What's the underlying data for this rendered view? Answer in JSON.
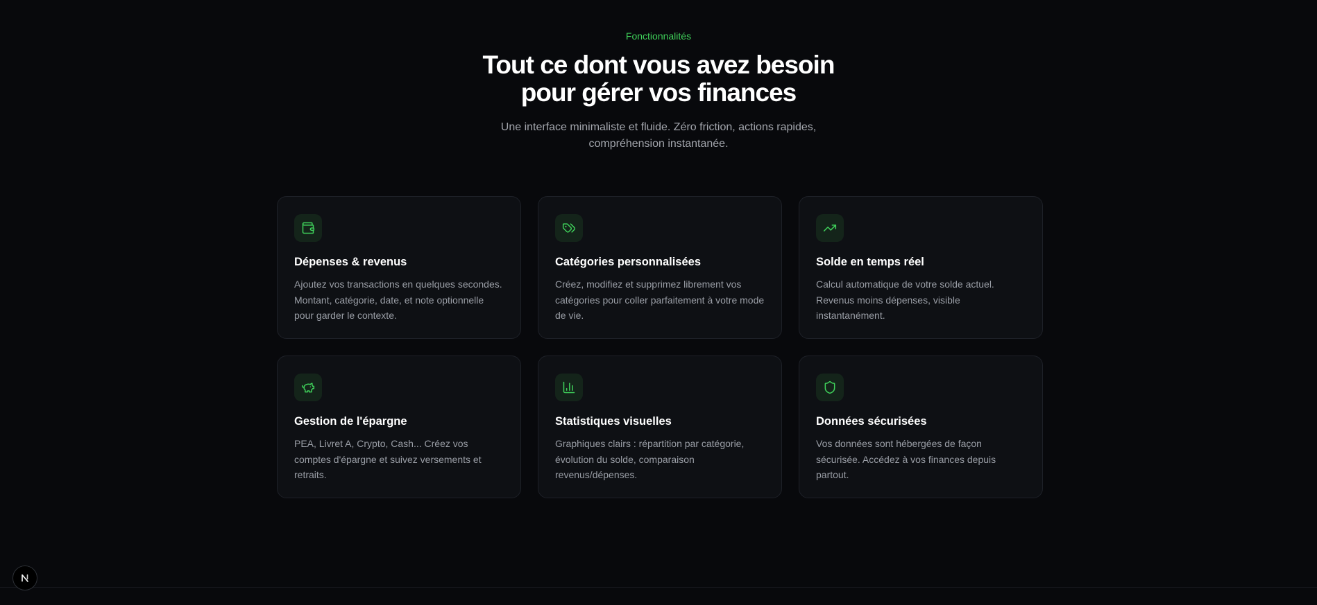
{
  "section": {
    "eyebrow": "Fonctionnalités",
    "title_line1": "Tout ce dont vous avez besoin",
    "title_line2": "pour gérer vos finances",
    "subtitle_line1": "Une interface minimaliste et fluide. Zéro friction, actions rapides,",
    "subtitle_line2": "compréhension instantanée."
  },
  "colors": {
    "background": "#08090c",
    "card_background": "#0e1014",
    "accent": "#3fd05a",
    "icon_bg": "#14241a"
  },
  "features": [
    {
      "icon": "wallet-icon",
      "title": "Dépenses & revenus",
      "description": "Ajoutez vos transactions en quelques secondes. Montant, catégorie, date, et note optionnelle pour garder le contexte."
    },
    {
      "icon": "tags-icon",
      "title": "Catégories personnalisées",
      "description": "Créez, modifiez et supprimez librement vos catégories pour coller parfaitement à votre mode de vie."
    },
    {
      "icon": "trending-up-icon",
      "title": "Solde en temps réel",
      "description": "Calcul automatique de votre solde actuel. Revenus moins dépenses, visible instantanément."
    },
    {
      "icon": "piggy-bank-icon",
      "title": "Gestion de l'épargne",
      "description": "PEA, Livret A, Crypto, Cash... Créez vos comptes d'épargne et suivez versements et retraits."
    },
    {
      "icon": "bar-chart-icon",
      "title": "Statistiques visuelles",
      "description": "Graphiques clairs : répartition par catégorie, évolution du solde, comparaison revenus/dépenses."
    },
    {
      "icon": "shield-icon",
      "title": "Données sécurisées",
      "description": "Vos données sont hébergées de façon sécurisée. Accédez à vos finances depuis partout."
    }
  ],
  "dev_badge": {
    "icon": "nextjs-logo-icon"
  }
}
